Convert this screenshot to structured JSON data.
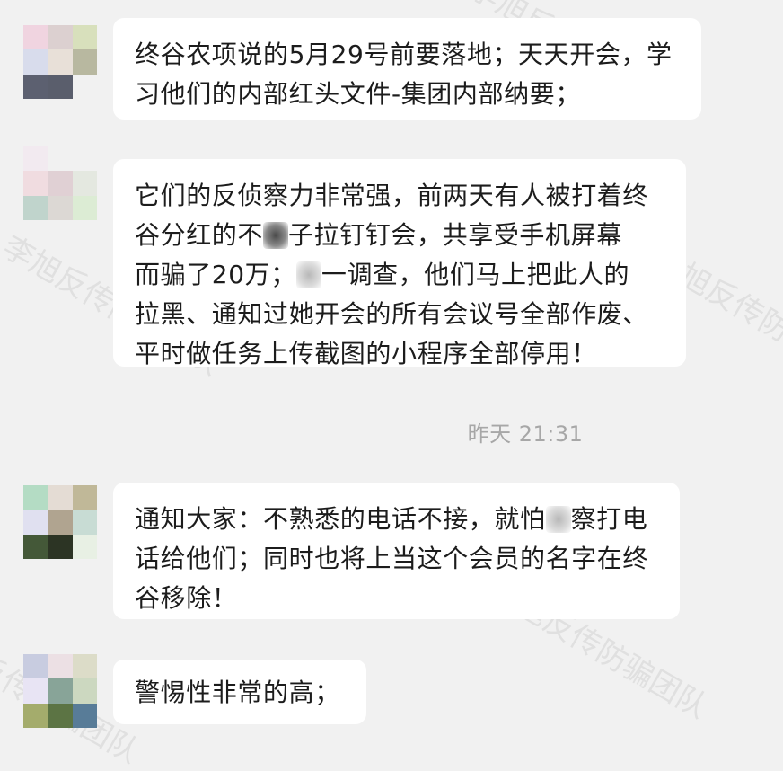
{
  "watermark": "李旭反传防骗团队",
  "timestamp": "昨天 21:31",
  "messages": [
    {
      "lines": [
        "终谷农项说的5月29号前要落地；天天开会，学",
        "习他们的内部红头文件-集团内部纳要；"
      ]
    },
    {
      "lines": [
        "它们的反侦察力非常强，前两天有人被打着终",
        "谷分红的不",
        "子拉钉钉会，共享受手机屏幕",
        "而骗了20万；",
        "一调查，他们马上把此人的",
        "拉黑、通知过她开会的所有会议号全部作废、",
        "平时做任务上传截图的小程序全部停用！"
      ]
    },
    {
      "lines": [
        "通知大家：不熟悉的电话不接，就怕",
        "察打电",
        "话给他们；同时也将上当这个会员的名字在终",
        "谷移除！"
      ]
    },
    {
      "lines": [
        "警惕性非常的高；"
      ]
    }
  ],
  "avatars": [
    [
      "#f0d4e0",
      "#dcd0d0",
      "#d8e0bc",
      "#d8dcec",
      "#e8e0d8",
      "#b8b8a0",
      "#5c6070",
      "#5a5e6c",
      "#f1f1f1"
    ],
    [
      "#f2eaf0",
      "#f1f1f1",
      "#f1f1f1",
      "#f0dce0",
      "#e0d0d4",
      "#e4e8e0",
      "#c0d4cc",
      "#dcd8d4",
      "#dcecd4"
    ],
    [
      "#b4dcc4",
      "#e4dcd4",
      "#c0b898",
      "#e0e0f0",
      "#b0a490",
      "#c8dcd4",
      "#445838",
      "#2c3424",
      "#e8f0e4"
    ],
    [
      "#c8cce0",
      "#ece0e4",
      "#dcdcc8",
      "#e8e4f4",
      "#88a498",
      "#ccd8c0",
      "#a4ac6c",
      "#5c7444",
      "#587c98"
    ]
  ]
}
